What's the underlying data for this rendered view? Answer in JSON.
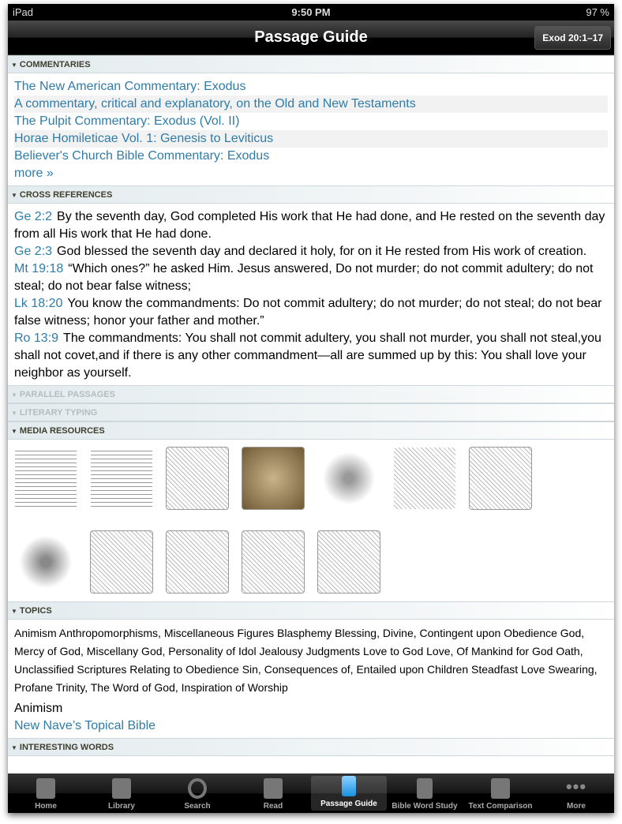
{
  "status": {
    "device": "iPad",
    "time": "9:50 PM",
    "battery": "97 %"
  },
  "nav": {
    "title": "Passage Guide",
    "reference": "Exod 20:1–17"
  },
  "commentaries": {
    "header": "COMMENTARIES",
    "items": [
      "The New American Commentary: Exodus",
      "A commentary, critical and explanatory, on the Old and New Testaments",
      "The Pulpit Commentary: Exodus (Vol. II)",
      "Horae Homileticae Vol. 1: Genesis to Leviticus",
      "Believer's Church Bible Commentary: Exodus"
    ],
    "more": "more »"
  },
  "cross_references": {
    "header": "CROSS REFERENCES",
    "items": [
      {
        "ref": "Ge 2:2",
        "text": "By the seventh day, God completed His work that He had done, and He rested on the seventh day from all His work that He had done."
      },
      {
        "ref": "Ge 2:3",
        "text": "God blessed the seventh day and declared it holy, for on it He rested from His work of creation."
      },
      {
        "ref": "Mt 19:18",
        "text": "“Which ones?” he asked Him. Jesus answered, Do not murder; do not commit adultery; do not steal; do not bear false witness;"
      },
      {
        "ref": "Lk 18:20",
        "text": "You know the commandments: Do not commit adultery; do not murder; do not steal; do not bear false witness; honor your father and mother.”"
      },
      {
        "ref": "Ro 13:9",
        "text": "The commandments: You shall not commit adultery, you shall not murder, you shall not steal,you shall not covet,and if there is any other commandment—all are summed up by this: You shall love your neighbor as yourself."
      }
    ]
  },
  "parallel": {
    "header": "PARALLEL PASSAGES"
  },
  "literary": {
    "header": "LITERARY TYPING"
  },
  "media": {
    "header": "MEDIA RESOURCES"
  },
  "topics": {
    "header": "TOPICS",
    "text": "Animism Anthropomorphisms, Miscellaneous Figures Blasphemy Blessing, Divine, Contingent upon Obedience God, Mercy of God, Miscellany God, Personality of Idol Jealousy Judgments Love to God Love, Of Mankind for God Oath, Unclassified Scriptures Relating to Obedience Sin, Consequences of, Entailed upon Children Steadfast Love Swearing, Profane Trinity, The Word of God, Inspiration of Worship",
    "selected": "Animism",
    "source": "New Nave’s Topical Bible"
  },
  "interesting": {
    "header": "INTERESTING WORDS"
  },
  "tabs": [
    "Home",
    "Library",
    "Search",
    "Read",
    "Passage Guide",
    "Bible Word Study",
    "Text Comparison",
    "More"
  ]
}
